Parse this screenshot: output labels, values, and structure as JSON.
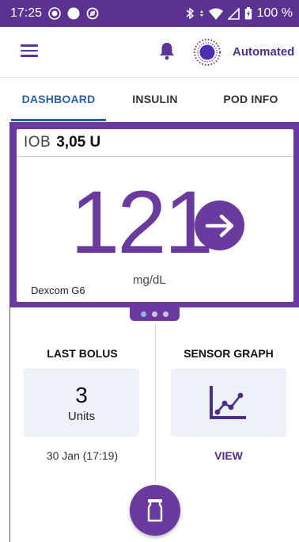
{
  "status_bar": {
    "time": "17:25",
    "battery": "100 %",
    "icons": [
      "record-icon",
      "circle-icon",
      "no-disturb-icon",
      "bluetooth-icon",
      "data-arrows-icon",
      "wifi-icon",
      "signal-icon",
      "battery-icon"
    ]
  },
  "app_bar": {
    "menu_icon": "hamburger-icon",
    "notification_icon": "bell-icon",
    "mode_label": "Automated"
  },
  "tabs": [
    {
      "label": "DASHBOARD",
      "active": true
    },
    {
      "label": "INSULIN",
      "active": false
    },
    {
      "label": "POD INFO",
      "active": false
    }
  ],
  "glucose_card": {
    "iob_label": "IOB",
    "iob_value": "3,05 U",
    "glucose_value": "121",
    "trend_icon": "arrow-right-icon",
    "units": "mg/dL",
    "sensor": "Dexcom G6"
  },
  "pager": {
    "count": 3,
    "active_index": 0
  },
  "last_bolus": {
    "title": "LAST BOLUS",
    "amount": "3",
    "unit": "Units",
    "time": "30 Jan (17:19)"
  },
  "sensor_graph": {
    "title": "SENSOR GRAPH",
    "icon": "line-chart-icon",
    "link": "VIEW"
  },
  "fab": {
    "icon": "bolus-vial-icon"
  },
  "colors": {
    "status_bar": "#5b3191",
    "brand_purple": "#6a3a9f",
    "tab_active": "#2b5ea6",
    "tile_bg": "#eef2f8"
  }
}
